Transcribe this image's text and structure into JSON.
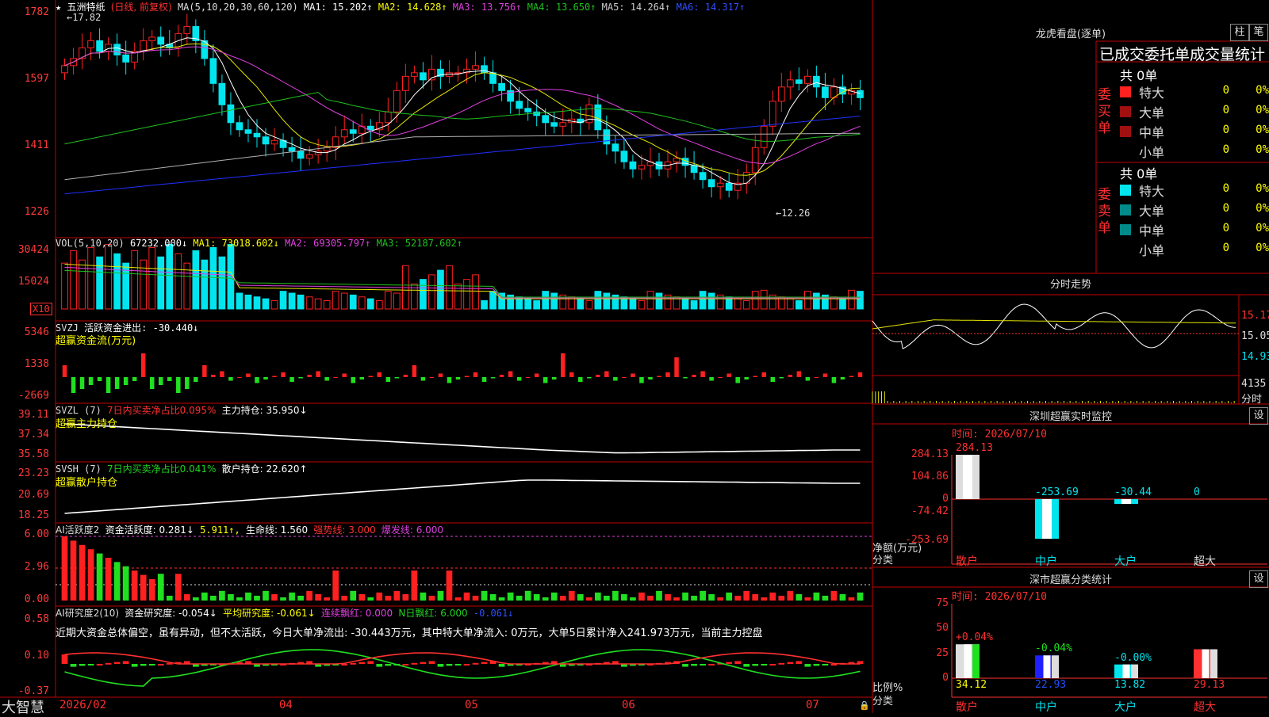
{
  "app": {
    "brand": "大智慧"
  },
  "colors": {
    "up": "#ff2020",
    "down": "#00e5ee",
    "ma1": "#ffffff",
    "ma2": "#e6e600",
    "ma3": "#e040e0",
    "ma4": "#20c020",
    "ma5": "#b0b0b0",
    "ma6": "#2020ff",
    "border": "#c00000"
  },
  "kline": {
    "stock_name": "五洲特纸",
    "mode": "(日线, 前复权)",
    "ma_label": "MA(5,10,20,30,60,120)",
    "ma1": "MA1: 15.202↑",
    "ma2": "MA2: 14.628↑",
    "ma3": "MA3: 13.756↑",
    "ma4": "MA4: 13.650↑",
    "ma5": "MA5: 14.264↑",
    "ma6": "MA6: 14.317↑",
    "high_mark": "17.82",
    "low_mark": "12.26",
    "yticks": [
      "1782",
      "1597",
      "1411",
      "1226"
    ]
  },
  "vol": {
    "label": "VOL(5,10,20)",
    "value": "67232.000↓",
    "ma1": "MA1: 73018.602↓",
    "ma2": "MA2: 69305.797↑",
    "ma3": "MA3: 52187.602↑",
    "yticks": [
      "30424",
      "15024"
    ],
    "unit": "X10"
  },
  "svzj": {
    "label": "SVZJ",
    "desc": "活跃资金进出: -30.440↓",
    "title": "超赢资金流(万元)",
    "yticks": [
      "5346",
      "1338",
      "-2669"
    ]
  },
  "svzl": {
    "label": "SVZL (7)",
    "ratio": "7日内买卖净占比0.095%",
    "desc": "主力持仓: 35.950↓",
    "title": "超赢主力持仓",
    "yticks": [
      "39.11",
      "37.34",
      "35.58"
    ]
  },
  "svsh": {
    "label": "SVSH (7)",
    "ratio": "7日内买卖净占比0.041%",
    "desc": "散户持仓: 22.620↑",
    "title": "超赢散户持仓",
    "yticks": [
      "23.23",
      "20.69",
      "18.25"
    ]
  },
  "ai_active": {
    "label": "AI活跃度2",
    "desc": "资金活跃度: 0.281↓",
    "v2": "5.911",
    "life": "生命线: 1.560",
    "strong": "强势线: 3.000",
    "burst": "爆发线: 6.000",
    "yticks": [
      "6.00",
      "2.96",
      "0.00"
    ]
  },
  "ai_research": {
    "label": "AI研究度2(10)",
    "desc": "资金研究度: -0.054↓",
    "avg": "平均研究度: -0.061↓",
    "cont": "连续飘红: 0.000",
    "nday": "N日飘红: 6.000",
    "last": "-0.061↓",
    "commentary": "近期大资金总体偏空，虽有异动，但不太活跃，今日大单净流出: -30.443万元，其中特大单净流入: 0万元，大单5日累计净入241.973万元，当前主力控盘",
    "yticks": [
      "0.58",
      "0.10",
      "-0.37"
    ]
  },
  "xaxis": {
    "labels": [
      "2026/02",
      "04",
      "05",
      "06",
      "07"
    ]
  },
  "dragon": {
    "title": "龙虎看盘(逐单)",
    "btn1": "柱",
    "btn2": "笔",
    "header": "已成交委托单成交量统计",
    "buy_label": "委买单",
    "sell_label": "委卖单",
    "buy_total": "共 0单",
    "sell_total": "共 0单",
    "rows": [
      {
        "name": "特大",
        "val": "0",
        "pct": "0%"
      },
      {
        "name": "大单",
        "val": "0",
        "pct": "0%"
      },
      {
        "name": "中单",
        "val": "0",
        "pct": "0%"
      },
      {
        "name": "小单",
        "val": "0",
        "pct": "0%"
      }
    ]
  },
  "intraday": {
    "title": "分时走势",
    "prices": [
      "15.17",
      "15.05",
      "14.93"
    ],
    "vol": "4135",
    "vol_unit": "分时"
  },
  "sz_monitor": {
    "title": "深圳超赢实时监控",
    "btn": "设",
    "time": "时间: 2026/07/10",
    "yticks": [
      "284.13",
      "104.86",
      "0",
      "-74.42",
      "-253.69"
    ],
    "ylabel": "净额(万元)",
    "xlabel": "分类",
    "bars": [
      {
        "name": "散户",
        "value": 284.13,
        "label": "284.13"
      },
      {
        "name": "中户",
        "value": -253.69,
        "label": "-253.69"
      },
      {
        "name": "大户",
        "value": -30.44,
        "label": "-30.44"
      },
      {
        "name": "超大",
        "value": 0,
        "label": "0"
      }
    ]
  },
  "sz_class": {
    "title": "深市超赢分类统计",
    "btn": "设",
    "time": "时间: 2026/07/10",
    "yticks": [
      "75",
      "50",
      "25",
      "0"
    ],
    "ylabel": "比例%",
    "xlabel": "分类",
    "bars": [
      {
        "name": "散户",
        "value": 34.12,
        "label": "34.12",
        "delta": "+0.04%"
      },
      {
        "name": "中户",
        "value": 22.93,
        "label": "22.93",
        "delta": "-0.04%"
      },
      {
        "name": "大户",
        "value": 13.82,
        "label": "13.82",
        "delta": "-0.00%"
      },
      {
        "name": "超大",
        "value": 29.13,
        "label": "29.13",
        "delta": ""
      }
    ]
  }
}
